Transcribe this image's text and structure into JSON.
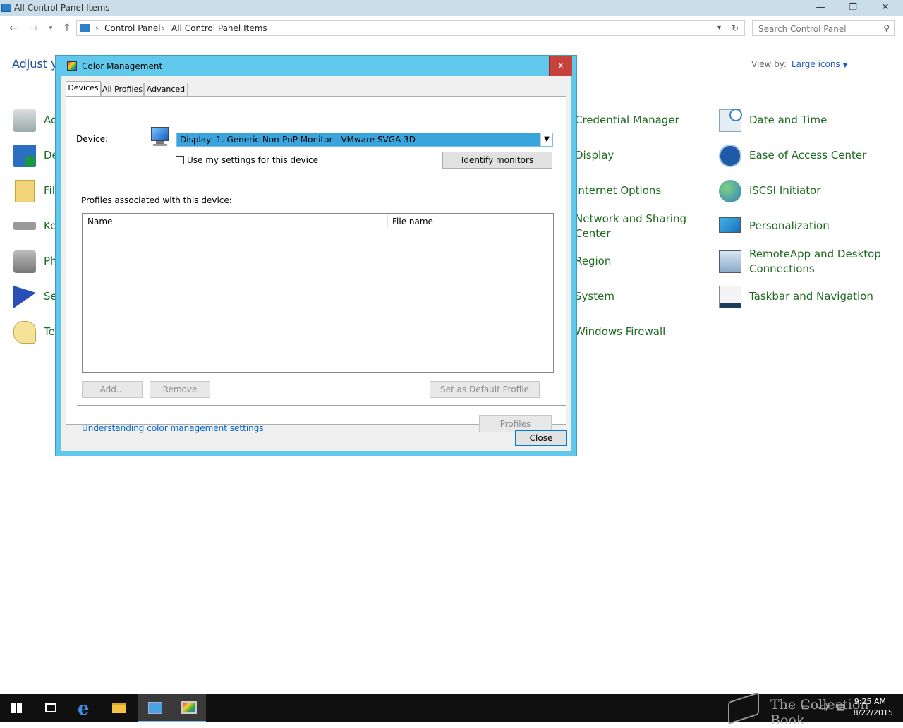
{
  "window": {
    "title": "All Control Panel Items",
    "controls": {
      "minimize": "—",
      "restore": "❐",
      "close": "✕"
    }
  },
  "address": {
    "crumbs": [
      "Control Panel",
      "All Control Panel Items"
    ],
    "search_placeholder": "Search Control Panel"
  },
  "content": {
    "heading": "Adjust yo",
    "view_by_label": "View by:",
    "view_by_value": "Large icons"
  },
  "left_column_items": [
    "Ad",
    "De",
    "Fil",
    "Ke",
    "Ph",
    "Se",
    "Te"
  ],
  "middle_column_items": [
    {
      "label": "Credential Manager",
      "icon": "credential-icon"
    },
    {
      "label": "Display",
      "icon": "display-icon"
    },
    {
      "label": "Internet Options",
      "icon": "internet-icon"
    },
    {
      "label": "Network and Sharing Center",
      "icon": "network-icon"
    },
    {
      "label": "Region",
      "icon": "region-icon"
    },
    {
      "label": "System",
      "icon": "system-icon"
    },
    {
      "label": "Windows Firewall",
      "icon": "firewall-icon"
    }
  ],
  "right_column_items": [
    {
      "label": "Date and Time",
      "icon": "clock-icon"
    },
    {
      "label": "Ease of Access Center",
      "icon": "accessibility-icon"
    },
    {
      "label": "iSCSI Initiator",
      "icon": "iscsi-icon"
    },
    {
      "label": "Personalization",
      "icon": "personalization-icon"
    },
    {
      "label": "RemoteApp and Desktop Connections",
      "icon": "remoteapp-icon"
    },
    {
      "label": "Taskbar and Navigation",
      "icon": "taskbar-icon"
    }
  ],
  "dialog": {
    "title": "Color Management",
    "close": "x",
    "tabs": [
      "Devices",
      "All Profiles",
      "Advanced"
    ],
    "device_label": "Device:",
    "device_value": "Display: 1. Generic Non-PnP Monitor - VMware SVGA 3D",
    "use_settings_label": "Use my settings for this device",
    "identify_button": "Identify monitors",
    "profiles_label": "Profiles associated with this device:",
    "columns": [
      "Name",
      "File name"
    ],
    "add_button": "Add...",
    "remove_button": "Remove",
    "set_default_button": "Set as Default Profile",
    "help_link": "Understanding color management settings",
    "profiles_button": "Profiles",
    "close_button": "Close"
  },
  "taskbar": {
    "time": "9:25 AM",
    "date": "8/22/2015",
    "watermark": "The Collection Book"
  },
  "colors": {
    "dialog_frame": "#60c8ea",
    "dialog_close": "#c7423a",
    "link_green": "#1e6a20",
    "selection_blue": "#3aa5dc"
  }
}
